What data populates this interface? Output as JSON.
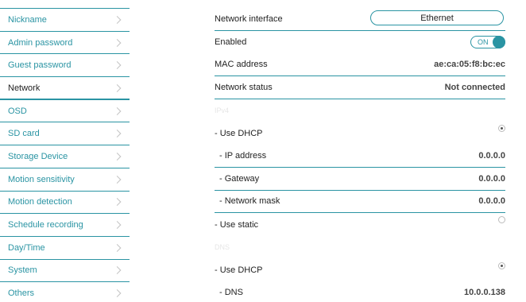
{
  "sidebar": {
    "items": [
      {
        "label": "Nickname"
      },
      {
        "label": "Admin password"
      },
      {
        "label": "Guest password"
      },
      {
        "label": "Network"
      },
      {
        "label": "OSD"
      },
      {
        "label": "SD card"
      },
      {
        "label": "Storage Device"
      },
      {
        "label": "Motion sensitivity"
      },
      {
        "label": "Motion detection"
      },
      {
        "label": "Schedule recording"
      },
      {
        "label": "Day/Time"
      },
      {
        "label": "System"
      },
      {
        "label": "Others"
      }
    ],
    "active_index": 3
  },
  "network": {
    "interface_label": "Network interface",
    "interface_value": "Ethernet",
    "enabled_label": "Enabled",
    "enabled_state": "ON",
    "mac_label": "MAC address",
    "mac_value": "ae:ca:05:f8:bc:ec",
    "status_label": "Network status",
    "status_value": "Not connected",
    "ip_section_label": "IPv4",
    "dhcp_label": "- Use DHCP",
    "dhcp_selected": true,
    "ip_label": "- IP address",
    "ip_value": "0.0.0.0",
    "gateway_label": "- Gateway",
    "gateway_value": "0.0.0.0",
    "mask_label": "- Network mask",
    "mask_value": "0.0.0.0",
    "static_label": "- Use static",
    "static_selected": false,
    "dns_section_label": "DNS",
    "dns_dhcp_label": "- Use DHCP",
    "dns_dhcp_selected": true,
    "dns_label": "- DNS",
    "dns_value": "10.0.0.138"
  },
  "colors": {
    "accent": "#2a94a3"
  }
}
